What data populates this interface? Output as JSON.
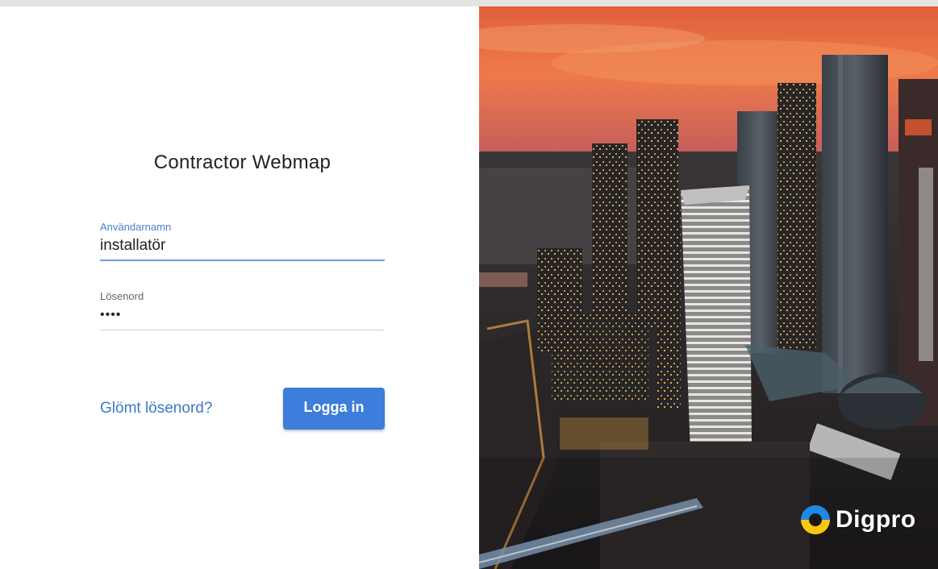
{
  "login": {
    "title": "Contractor Webmap",
    "username_label": "Användarnamn",
    "username_value": "installatör",
    "password_label": "Lösenord",
    "password_value": "••••",
    "forgot_label": "Glömt lösenord?",
    "login_button": "Logga in"
  },
  "brand": {
    "logo_text": "Digpro",
    "logo_colors": {
      "blue": "#1e88e5",
      "yellow": "#f9c80e"
    }
  },
  "colors": {
    "accent": "#3d7ddb",
    "link": "#3e79c9"
  }
}
